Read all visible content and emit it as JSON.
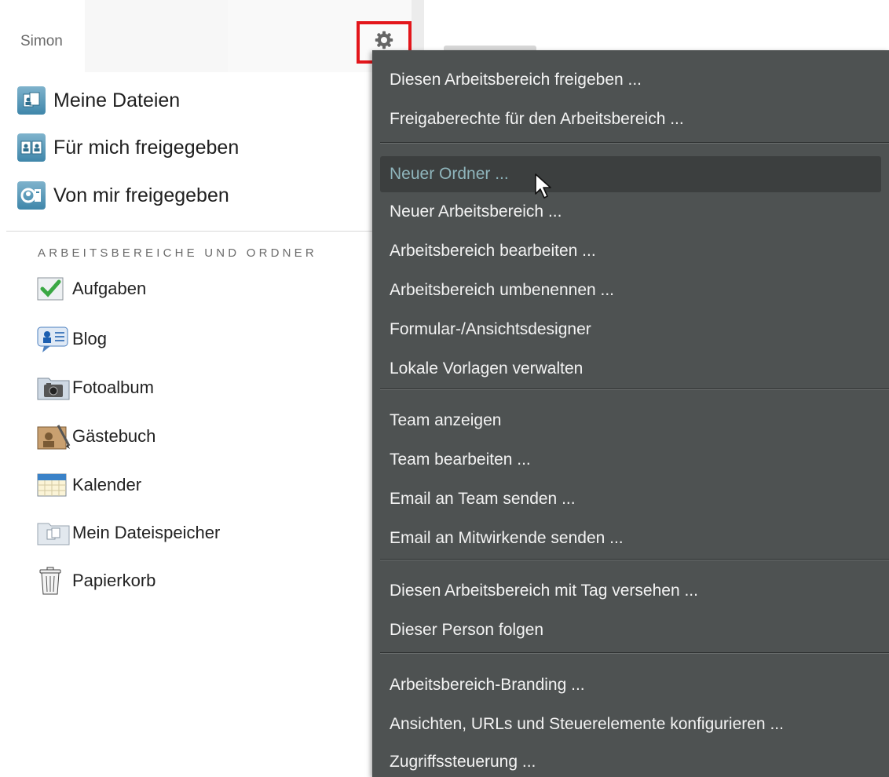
{
  "header": {
    "user_name": "Simon",
    "settings_icon": "gear-icon"
  },
  "quick_links": [
    {
      "label": "Meine Dateien",
      "icon": "my-files-icon"
    },
    {
      "label": "Für mich freigegeben",
      "icon": "shared-with-me-icon"
    },
    {
      "label": "Von mir freigegeben",
      "icon": "shared-by-me-icon"
    }
  ],
  "sidebar": {
    "section_title": "ARBEITSBEREICHE UND ORDNER",
    "items": [
      {
        "label": "Aufgaben",
        "icon": "tasks-icon"
      },
      {
        "label": "Blog",
        "icon": "blog-icon"
      },
      {
        "label": "Fotoalbum",
        "icon": "photo-album-icon"
      },
      {
        "label": "Gästebuch",
        "icon": "guestbook-icon"
      },
      {
        "label": "Kalender",
        "icon": "calendar-icon"
      },
      {
        "label": "Mein Dateispeicher",
        "icon": "file-storage-icon"
      },
      {
        "label": "Papierkorb",
        "icon": "trash-icon"
      }
    ]
  },
  "context_menu": {
    "items": [
      {
        "label": "Diesen Arbeitsbereich freigeben ..."
      },
      {
        "label": "Freigaberechte für den Arbeitsbereich ..."
      },
      {
        "label": "Neuer Ordner ...",
        "highlighted": true
      },
      {
        "label": "Neuer Arbeitsbereich ..."
      },
      {
        "label": "Arbeitsbereich bearbeiten ..."
      },
      {
        "label": "Arbeitsbereich umbenennen ..."
      },
      {
        "label": "Formular-/Ansichtsdesigner"
      },
      {
        "label": "Lokale Vorlagen verwalten"
      },
      {
        "label": "Team anzeigen"
      },
      {
        "label": "Team bearbeiten ..."
      },
      {
        "label": "Email an Team senden ..."
      },
      {
        "label": "Email an Mitwirkende senden ..."
      },
      {
        "label": "Diesen Arbeitsbereich mit Tag versehen ..."
      },
      {
        "label": "Dieser Person folgen"
      },
      {
        "label": "Arbeitsbereich-Branding ..."
      },
      {
        "label": "Ansichten, URLs und Steuerelemente konfigurieren ..."
      },
      {
        "label": "Zugriffssteuerung ..."
      }
    ]
  },
  "colors": {
    "menu_background": "#4e5252",
    "menu_highlight_text": "#8fb5bc",
    "settings_outline": "#e3161b"
  }
}
